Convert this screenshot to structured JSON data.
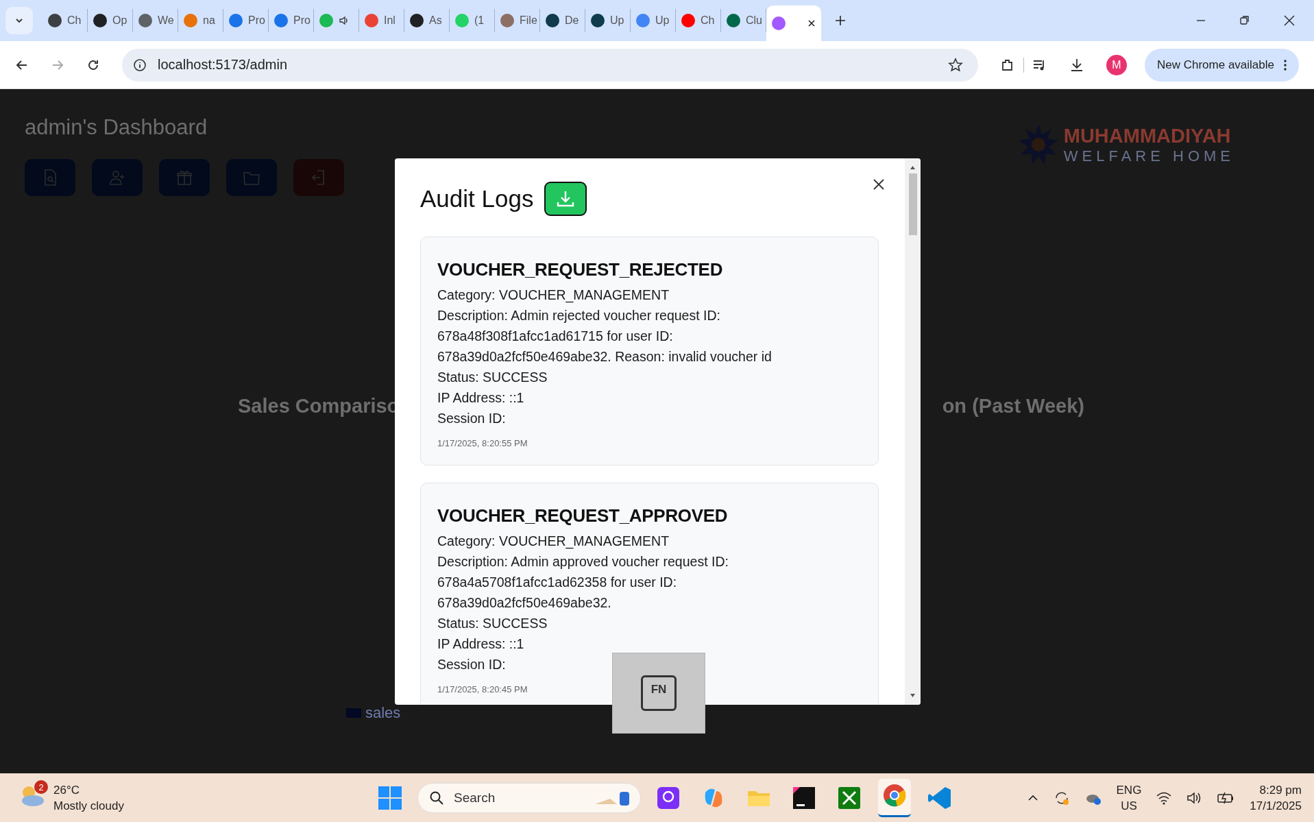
{
  "browser": {
    "tabs": [
      {
        "label": "Ch",
        "color": "#3c4043",
        "selected": false
      },
      {
        "label": "Op",
        "color": "#202124",
        "selected": false
      },
      {
        "label": "We",
        "color": "#5f6368",
        "selected": false
      },
      {
        "label": "na",
        "color": "#e8710a",
        "selected": false
      },
      {
        "label": "Pro",
        "color": "#1a73e8",
        "selected": false
      },
      {
        "label": "Pro",
        "color": "#1a73e8",
        "selected": false
      },
      {
        "color": "#1db954",
        "selected": false,
        "audio": true
      },
      {
        "label": "Inl",
        "color": "#ea4335",
        "selected": false
      },
      {
        "label": "As",
        "color": "#202124",
        "selected": false
      },
      {
        "label": "(1",
        "color": "#25d366",
        "selected": false
      },
      {
        "label": "File",
        "color": "#8d6e63",
        "selected": false
      },
      {
        "label": "De",
        "color": "#0f3b4c",
        "selected": false
      },
      {
        "label": "Up",
        "color": "#0f3b4c",
        "selected": false
      },
      {
        "label": "Up",
        "color": "#4285f4",
        "selected": false
      },
      {
        "label": "Ch",
        "color": "#ff0000",
        "selected": false
      },
      {
        "label": "Clu",
        "color": "#00684a",
        "selected": false
      },
      {
        "color": "#a259ff",
        "selected": true
      }
    ],
    "address": "localhost:5173/admin",
    "profile_initial": "M",
    "update_button": "New Chrome available"
  },
  "dashboard": {
    "title": "admin's Dashboard",
    "actions": [
      {
        "kind": "document-search",
        "danger": false
      },
      {
        "kind": "add-user",
        "danger": false
      },
      {
        "kind": "gift",
        "danger": false
      },
      {
        "kind": "folder",
        "danger": false
      },
      {
        "kind": "logout",
        "danger": true
      }
    ],
    "logo": {
      "line_1": "MUHAMMADIYAH",
      "line_2": "WELFARE HOME"
    },
    "chart_titles": [
      "Sales Compariso",
      "on (Past Week)"
    ],
    "legend": "sales"
  },
  "modal": {
    "title": "Audit Logs",
    "logs": [
      {
        "action": "VOUCHER_REQUEST_REJECTED",
        "lines": [
          "Category: VOUCHER_MANAGEMENT",
          "Description: Admin rejected voucher request ID: 678a48f308f1afcc1ad61715 for user ID: 678a39d0a2fcf50e469abe32. Reason: invalid voucher id",
          "Status: SUCCESS",
          "IP Address: ::1",
          "Session ID:"
        ],
        "timestamp": "1/17/2025, 8:20:55 PM"
      },
      {
        "action": "VOUCHER_REQUEST_APPROVED",
        "lines": [
          "Category: VOUCHER_MANAGEMENT",
          "Description: Admin approved voucher request ID: 678a4a5708f1afcc1ad62358 for user ID: 678a39d0a2fcf50e469abe32.",
          "Status: SUCCESS",
          "IP Address: ::1",
          "Session ID:"
        ],
        "timestamp": "1/17/2025, 8:20:45 PM"
      }
    ]
  },
  "key_overlay": {
    "key": "FN"
  },
  "taskbar": {
    "temperature": "26°C",
    "weather": "Mostly cloudy",
    "weather_badge": "2",
    "search_placeholder": "Search",
    "language": "ENG",
    "region": "US",
    "time": "8:29 pm",
    "date": "17/1/2025"
  }
}
